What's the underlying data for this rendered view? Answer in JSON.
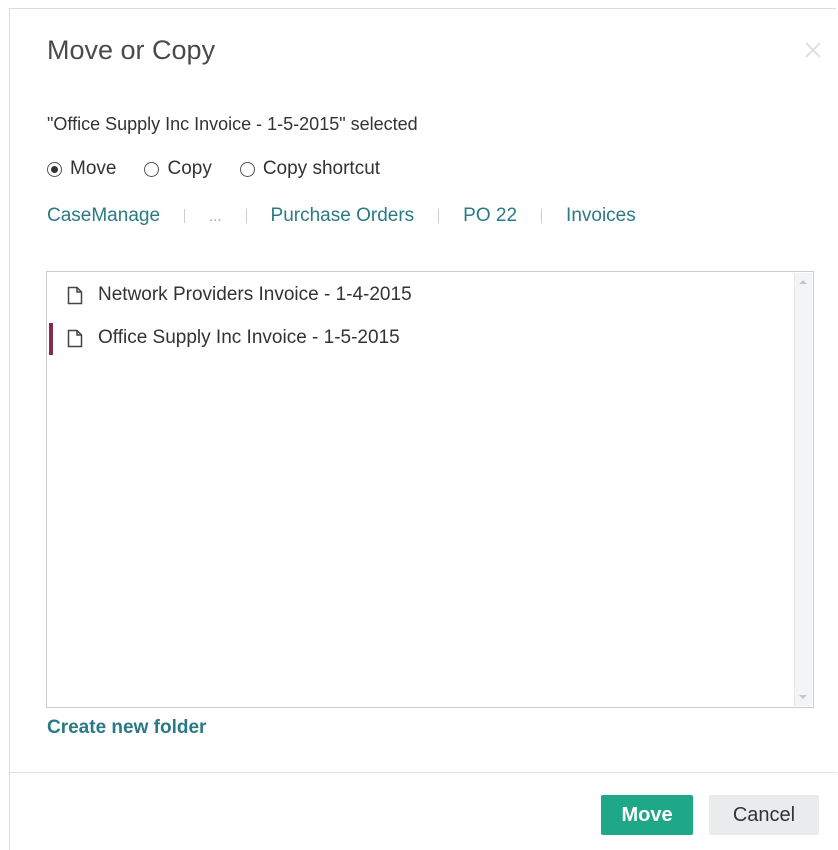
{
  "dialog": {
    "title": "Move or Copy",
    "selected_text": "\"Office Supply Inc Invoice - 1-5-2015\" selected"
  },
  "options": [
    {
      "label": "Move",
      "checked": true
    },
    {
      "label": "Copy",
      "checked": false
    },
    {
      "label": "Copy shortcut",
      "checked": false
    }
  ],
  "breadcrumb": [
    "CaseManage",
    "...",
    "Purchase Orders",
    "PO 22",
    "Invoices"
  ],
  "files": [
    {
      "name": "Network Providers Invoice - 1-4-2015",
      "icon": "document-icon",
      "selected": false
    },
    {
      "name": "Office Supply Inc Invoice - 1-5-2015",
      "icon": "document-icon",
      "selected": true
    }
  ],
  "create_folder_label": "Create new folder",
  "buttons": {
    "move": "Move",
    "cancel": "Cancel"
  },
  "colors": {
    "link": "#2a7a86",
    "primary": "#1ea887",
    "selection_marker": "#8a2a48"
  }
}
